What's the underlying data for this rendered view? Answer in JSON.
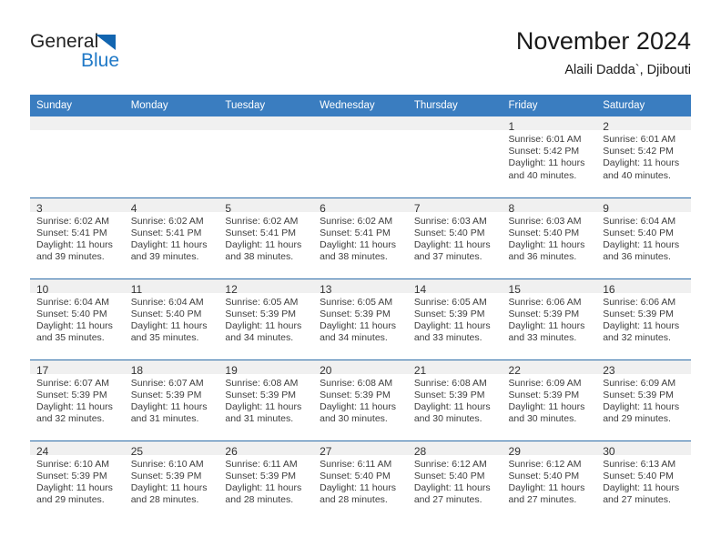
{
  "logo": {
    "word_top": "General",
    "word_bottom": "Blue",
    "triangle_color": "#1265b0",
    "blue_color": "#2079c7"
  },
  "header": {
    "title": "November 2024",
    "subtitle": "Alaili Dadda`, Djibouti"
  },
  "theme": {
    "header_bg": "#3a7dc0",
    "header_text": "#ffffff",
    "daynum_bg": "#f0f0f0",
    "row_border": "#2c6ca8"
  },
  "calendar": {
    "weekdays": [
      "Sunday",
      "Monday",
      "Tuesday",
      "Wednesday",
      "Thursday",
      "Friday",
      "Saturday"
    ],
    "labels": {
      "sunrise": "Sunrise:",
      "sunset": "Sunset:",
      "daylight": "Daylight:"
    },
    "weeks": [
      [
        {
          "day": "",
          "blank": true
        },
        {
          "day": "",
          "blank": true
        },
        {
          "day": "",
          "blank": true
        },
        {
          "day": "",
          "blank": true
        },
        {
          "day": "",
          "blank": true
        },
        {
          "day": "1",
          "sunrise": "Sunrise: 6:01 AM",
          "sunset": "Sunset: 5:42 PM",
          "daylight1": "Daylight: 11 hours",
          "daylight2": "and 40 minutes."
        },
        {
          "day": "2",
          "sunrise": "Sunrise: 6:01 AM",
          "sunset": "Sunset: 5:42 PM",
          "daylight1": "Daylight: 11 hours",
          "daylight2": "and 40 minutes."
        }
      ],
      [
        {
          "day": "3",
          "sunrise": "Sunrise: 6:02 AM",
          "sunset": "Sunset: 5:41 PM",
          "daylight1": "Daylight: 11 hours",
          "daylight2": "and 39 minutes."
        },
        {
          "day": "4",
          "sunrise": "Sunrise: 6:02 AM",
          "sunset": "Sunset: 5:41 PM",
          "daylight1": "Daylight: 11 hours",
          "daylight2": "and 39 minutes."
        },
        {
          "day": "5",
          "sunrise": "Sunrise: 6:02 AM",
          "sunset": "Sunset: 5:41 PM",
          "daylight1": "Daylight: 11 hours",
          "daylight2": "and 38 minutes."
        },
        {
          "day": "6",
          "sunrise": "Sunrise: 6:02 AM",
          "sunset": "Sunset: 5:41 PM",
          "daylight1": "Daylight: 11 hours",
          "daylight2": "and 38 minutes."
        },
        {
          "day": "7",
          "sunrise": "Sunrise: 6:03 AM",
          "sunset": "Sunset: 5:40 PM",
          "daylight1": "Daylight: 11 hours",
          "daylight2": "and 37 minutes."
        },
        {
          "day": "8",
          "sunrise": "Sunrise: 6:03 AM",
          "sunset": "Sunset: 5:40 PM",
          "daylight1": "Daylight: 11 hours",
          "daylight2": "and 36 minutes."
        },
        {
          "day": "9",
          "sunrise": "Sunrise: 6:04 AM",
          "sunset": "Sunset: 5:40 PM",
          "daylight1": "Daylight: 11 hours",
          "daylight2": "and 36 minutes."
        }
      ],
      [
        {
          "day": "10",
          "sunrise": "Sunrise: 6:04 AM",
          "sunset": "Sunset: 5:40 PM",
          "daylight1": "Daylight: 11 hours",
          "daylight2": "and 35 minutes."
        },
        {
          "day": "11",
          "sunrise": "Sunrise: 6:04 AM",
          "sunset": "Sunset: 5:40 PM",
          "daylight1": "Daylight: 11 hours",
          "daylight2": "and 35 minutes."
        },
        {
          "day": "12",
          "sunrise": "Sunrise: 6:05 AM",
          "sunset": "Sunset: 5:39 PM",
          "daylight1": "Daylight: 11 hours",
          "daylight2": "and 34 minutes."
        },
        {
          "day": "13",
          "sunrise": "Sunrise: 6:05 AM",
          "sunset": "Sunset: 5:39 PM",
          "daylight1": "Daylight: 11 hours",
          "daylight2": "and 34 minutes."
        },
        {
          "day": "14",
          "sunrise": "Sunrise: 6:05 AM",
          "sunset": "Sunset: 5:39 PM",
          "daylight1": "Daylight: 11 hours",
          "daylight2": "and 33 minutes."
        },
        {
          "day": "15",
          "sunrise": "Sunrise: 6:06 AM",
          "sunset": "Sunset: 5:39 PM",
          "daylight1": "Daylight: 11 hours",
          "daylight2": "and 33 minutes."
        },
        {
          "day": "16",
          "sunrise": "Sunrise: 6:06 AM",
          "sunset": "Sunset: 5:39 PM",
          "daylight1": "Daylight: 11 hours",
          "daylight2": "and 32 minutes."
        }
      ],
      [
        {
          "day": "17",
          "sunrise": "Sunrise: 6:07 AM",
          "sunset": "Sunset: 5:39 PM",
          "daylight1": "Daylight: 11 hours",
          "daylight2": "and 32 minutes."
        },
        {
          "day": "18",
          "sunrise": "Sunrise: 6:07 AM",
          "sunset": "Sunset: 5:39 PM",
          "daylight1": "Daylight: 11 hours",
          "daylight2": "and 31 minutes."
        },
        {
          "day": "19",
          "sunrise": "Sunrise: 6:08 AM",
          "sunset": "Sunset: 5:39 PM",
          "daylight1": "Daylight: 11 hours",
          "daylight2": "and 31 minutes."
        },
        {
          "day": "20",
          "sunrise": "Sunrise: 6:08 AM",
          "sunset": "Sunset: 5:39 PM",
          "daylight1": "Daylight: 11 hours",
          "daylight2": "and 30 minutes."
        },
        {
          "day": "21",
          "sunrise": "Sunrise: 6:08 AM",
          "sunset": "Sunset: 5:39 PM",
          "daylight1": "Daylight: 11 hours",
          "daylight2": "and 30 minutes."
        },
        {
          "day": "22",
          "sunrise": "Sunrise: 6:09 AM",
          "sunset": "Sunset: 5:39 PM",
          "daylight1": "Daylight: 11 hours",
          "daylight2": "and 30 minutes."
        },
        {
          "day": "23",
          "sunrise": "Sunrise: 6:09 AM",
          "sunset": "Sunset: 5:39 PM",
          "daylight1": "Daylight: 11 hours",
          "daylight2": "and 29 minutes."
        }
      ],
      [
        {
          "day": "24",
          "sunrise": "Sunrise: 6:10 AM",
          "sunset": "Sunset: 5:39 PM",
          "daylight1": "Daylight: 11 hours",
          "daylight2": "and 29 minutes."
        },
        {
          "day": "25",
          "sunrise": "Sunrise: 6:10 AM",
          "sunset": "Sunset: 5:39 PM",
          "daylight1": "Daylight: 11 hours",
          "daylight2": "and 28 minutes."
        },
        {
          "day": "26",
          "sunrise": "Sunrise: 6:11 AM",
          "sunset": "Sunset: 5:39 PM",
          "daylight1": "Daylight: 11 hours",
          "daylight2": "and 28 minutes."
        },
        {
          "day": "27",
          "sunrise": "Sunrise: 6:11 AM",
          "sunset": "Sunset: 5:40 PM",
          "daylight1": "Daylight: 11 hours",
          "daylight2": "and 28 minutes."
        },
        {
          "day": "28",
          "sunrise": "Sunrise: 6:12 AM",
          "sunset": "Sunset: 5:40 PM",
          "daylight1": "Daylight: 11 hours",
          "daylight2": "and 27 minutes."
        },
        {
          "day": "29",
          "sunrise": "Sunrise: 6:12 AM",
          "sunset": "Sunset: 5:40 PM",
          "daylight1": "Daylight: 11 hours",
          "daylight2": "and 27 minutes."
        },
        {
          "day": "30",
          "sunrise": "Sunrise: 6:13 AM",
          "sunset": "Sunset: 5:40 PM",
          "daylight1": "Daylight: 11 hours",
          "daylight2": "and 27 minutes."
        }
      ]
    ]
  }
}
